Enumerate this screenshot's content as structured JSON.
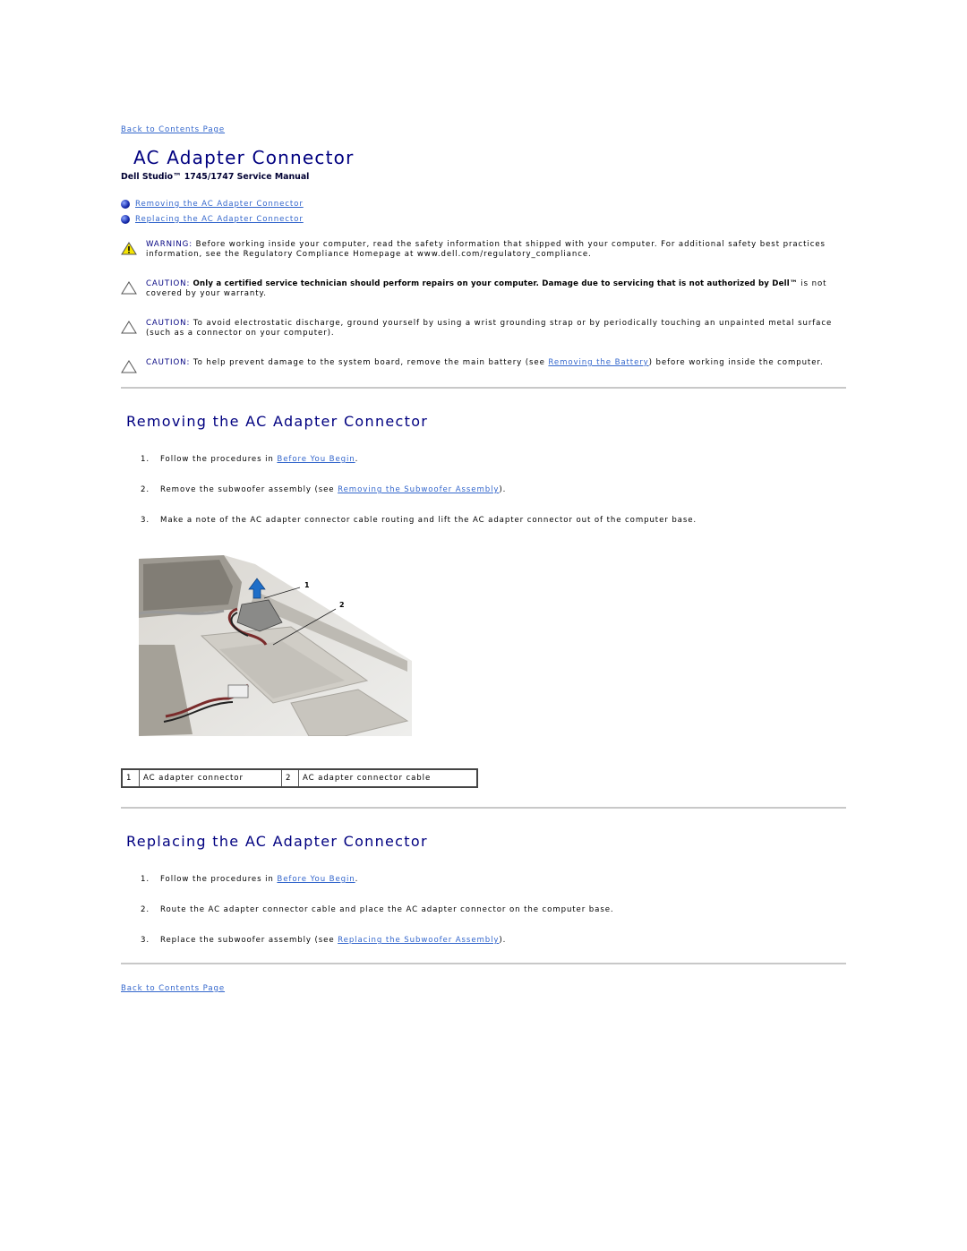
{
  "nav": {
    "back_top": "Back to Contents Page",
    "back_bottom": "Back to Contents Page"
  },
  "header": {
    "title": "AC Adapter Connector",
    "subtitle": "Dell Studio™ 1745/1747 Service Manual"
  },
  "toc": [
    {
      "label": "Removing the AC Adapter Connector",
      "icon": "blue-bullet-icon"
    },
    {
      "label": "Replacing the AC Adapter Connector",
      "icon": "blue-bullet-icon"
    }
  ],
  "notices": [
    {
      "icon": "warning-triangle-icon",
      "label": "WARNING:",
      "text": " Before working inside your computer, read the safety information that shipped with your computer. For additional safety best practices information, see the Regulatory Compliance Homepage at www.dell.com/regulatory_compliance."
    },
    {
      "icon": "caution-triangle-icon",
      "label": "CAUTION:",
      "bold_text": " Only a certified service technician should perform repairs on your computer. Damage due to servicing that is not authorized by Dell™",
      "text": " is not covered by your warranty."
    },
    {
      "icon": "caution-triangle-icon",
      "label": "CAUTION:",
      "text": " To avoid electrostatic discharge, ground yourself by using a wrist grounding strap or by periodically touching an unpainted metal surface (such as a connector on your computer)."
    },
    {
      "icon": "caution-triangle-icon",
      "label": "CAUTION:",
      "text_before": " To help prevent damage to the system board, remove the main battery (see ",
      "link": "Removing the Battery",
      "text_after": ") before working inside the computer."
    }
  ],
  "removing": {
    "heading": "Removing the AC Adapter Connector",
    "steps": [
      {
        "num": "1.",
        "before": "Follow the procedures in ",
        "link": "Before You Begin",
        "after": "."
      },
      {
        "num": "2.",
        "before": "Remove the subwoofer assembly (see ",
        "link": "Removing the Subwoofer Assembly",
        "after": ")."
      },
      {
        "num": "3.",
        "before": "Make a note of the AC adapter connector cable routing and lift the AC adapter connector out of the computer base.",
        "link": "",
        "after": ""
      }
    ],
    "figure": {
      "callouts": [
        "1",
        "2"
      ]
    },
    "legend": [
      {
        "num": "1",
        "label": "AC adapter connector"
      },
      {
        "num": "2",
        "label": "AC adapter connector cable"
      }
    ]
  },
  "replacing": {
    "heading": "Replacing the AC Adapter Connector",
    "steps": [
      {
        "num": "1.",
        "before": "Follow the procedures in ",
        "link": "Before You Begin",
        "after": "."
      },
      {
        "num": "2.",
        "before": "Route the AC adapter connector cable and place the AC adapter connector on the computer base.",
        "link": "",
        "after": ""
      },
      {
        "num": "3.",
        "before": "Replace the subwoofer assembly (see ",
        "link": "Replacing the Subwoofer Assembly",
        "after": ")."
      }
    ]
  }
}
